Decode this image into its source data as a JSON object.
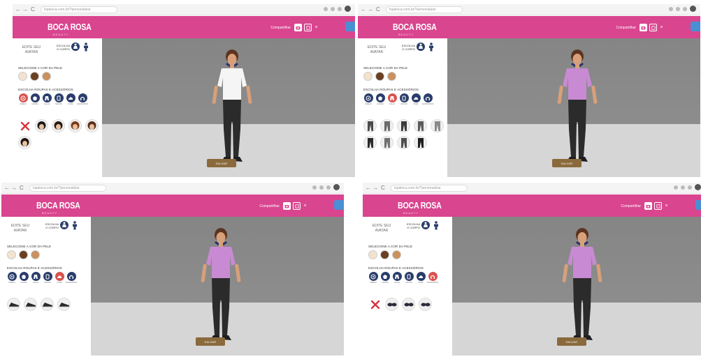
{
  "browser": {
    "back": "←",
    "forward": "→",
    "reload": "C",
    "url": "lojaboca.com.br/?personalizar"
  },
  "brand": {
    "name": "BOCA ROSA",
    "sub": "BEAUTY"
  },
  "header": {
    "link": "Compartilhar",
    "close": "×"
  },
  "sidebar": {
    "edit_title": "EDITE SEU AVATAR",
    "gender_label": "ESCOLHA O CORPO",
    "skin_label_variants": [
      "SELECIONE A COR DA PELE",
      "SELECIONE A COR DA PELE",
      "SELECIONE A COR DA PELE",
      "SELECIONE A COR DA PELE"
    ],
    "category_label": "ESCOLHA ROUPAS E ACESSÓRIOS",
    "categories": [
      "CABELO",
      "CAMISA",
      "CALÇA",
      "SAPATO",
      "FONE",
      "ACESSÓRIOS"
    ]
  },
  "colors": {
    "header_pink": "#d9458f",
    "nav_blue": "#2a3d6b",
    "active_red": "#d9534f",
    "save_brown": "#8a6a3c",
    "skin_light": "#f3e2cf",
    "skin_dark": "#6a3f22",
    "skin_medium": "#c9915f"
  },
  "panes": [
    {
      "active_category": 0,
      "option_type": "hair",
      "option_count": 6,
      "has_none": true,
      "shirt_color": "#f5f5f5"
    },
    {
      "active_category": 2,
      "option_type": "pants",
      "option_count": 9,
      "has_none": false,
      "shirt_color": "#c88ad2"
    },
    {
      "active_category": 4,
      "option_type": "shoes",
      "option_count": 4,
      "has_none": false,
      "shirt_color": "#c88ad2"
    },
    {
      "active_category": 5,
      "option_type": "accessory",
      "option_count": 4,
      "has_none": true,
      "shirt_color": "#c88ad2"
    }
  ],
  "save_label": "SALVAR"
}
